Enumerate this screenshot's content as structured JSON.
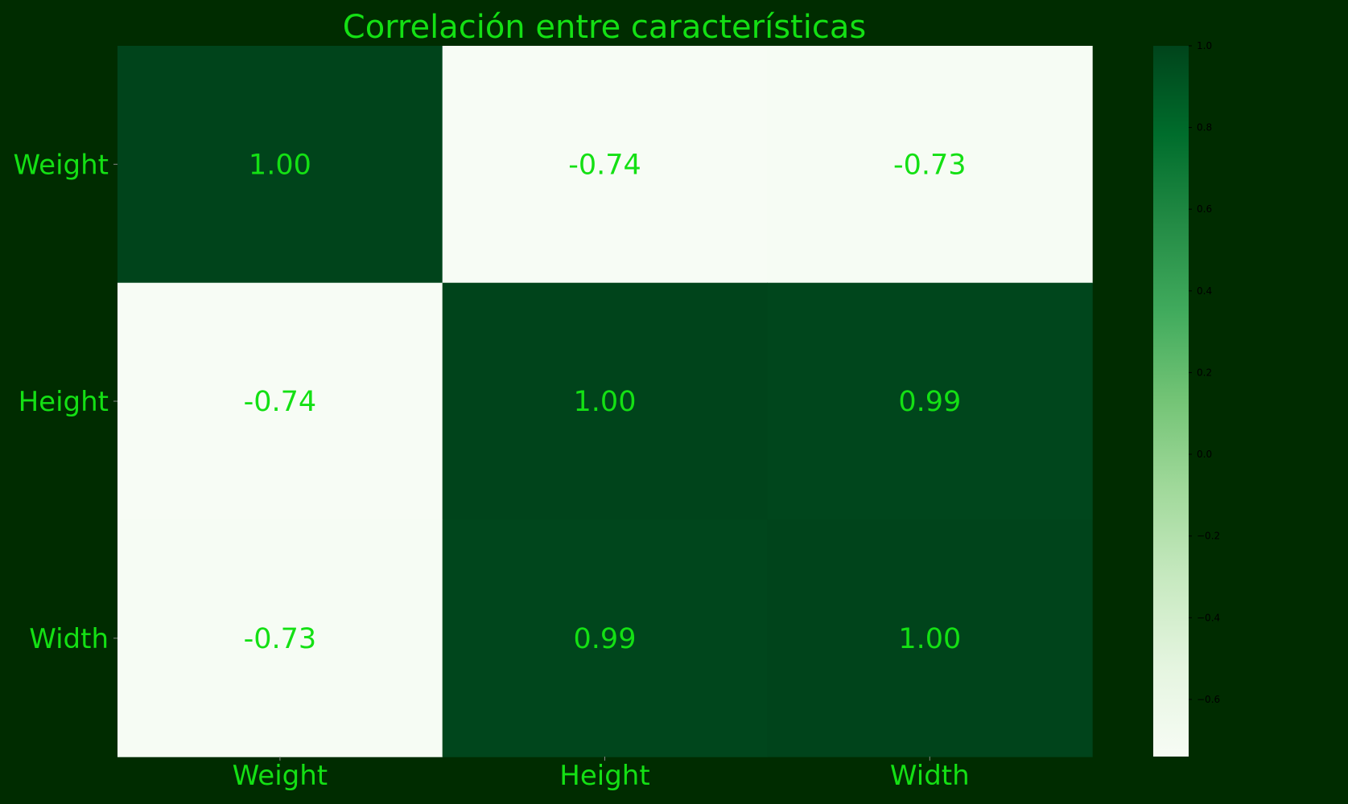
{
  "chart_data": {
    "type": "heatmap",
    "title": "Correlación entre características",
    "x_categories": [
      "Weight",
      "Height",
      "Width"
    ],
    "y_categories": [
      "Weight",
      "Height",
      "Width"
    ],
    "values": [
      [
        1.0,
        -0.74,
        -0.73
      ],
      [
        -0.74,
        1.0,
        0.99
      ],
      [
        -0.73,
        0.99,
        1.0
      ]
    ],
    "value_labels": [
      [
        "1.00",
        "-0.74",
        "-0.73"
      ],
      [
        "-0.74",
        "1.00",
        "0.99"
      ],
      [
        "-0.73",
        "0.99",
        "1.00"
      ]
    ],
    "colorbar": {
      "vmin": -0.74,
      "vmax": 1.0,
      "ticks": [
        1.0,
        0.8,
        0.6,
        0.4,
        0.2,
        0.0,
        -0.2,
        -0.4,
        -0.6
      ],
      "tick_labels": [
        "1.0",
        "0.8",
        "0.6",
        "0.4",
        "0.2",
        "0.0",
        "−0.2",
        "−0.4",
        "−0.6"
      ],
      "colormap": "Greens",
      "low_color": "#f7fcf5",
      "high_color": "#00441b"
    },
    "colors": {
      "background": "#002c00",
      "text": "#14e014",
      "colorbar_text": "#000000"
    }
  }
}
